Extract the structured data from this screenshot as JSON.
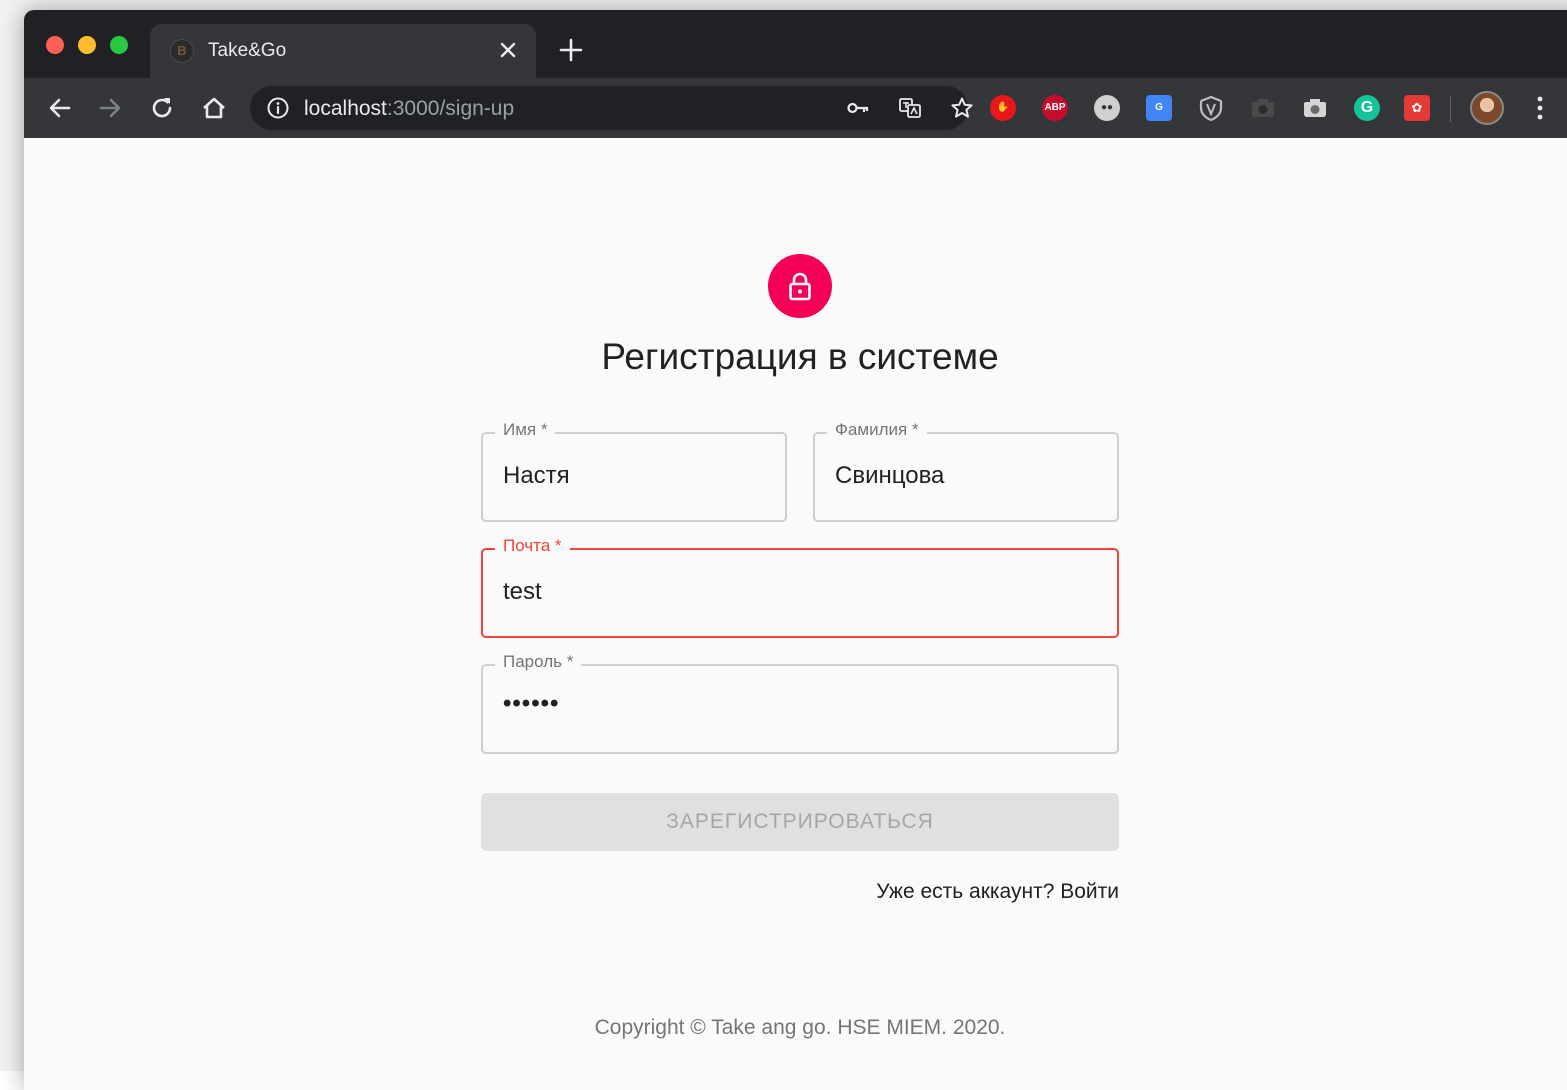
{
  "browser": {
    "tab": {
      "title": "Take&Go",
      "favicon_icon": "take-and-go-logo-icon",
      "close_icon": "close-icon"
    },
    "new_tab_icon": "plus-icon",
    "nav": {
      "back_icon": "arrow-left-icon",
      "forward_icon": "arrow-right-icon",
      "reload_icon": "reload-icon",
      "home_icon": "home-icon"
    },
    "omnibox": {
      "info_icon": "info-icon",
      "host": "localhost",
      "path": ":3000/sign-up",
      "actions": [
        "key-icon",
        "translate-icon",
        "star-icon"
      ]
    },
    "extensions": [
      {
        "name": "stop-hand-icon",
        "color": "#e8171c"
      },
      {
        "name": "adblock-plus-icon",
        "label": "ABP",
        "color": "#c70d2c"
      },
      {
        "name": "chat-bubble-icon",
        "color": "#d0d0d0"
      },
      {
        "name": "google-translate-icon",
        "color": "#4285f4"
      },
      {
        "name": "shield-icon",
        "color": "#bdbdbd"
      },
      {
        "name": "camera-dark-icon",
        "color": "#444444"
      },
      {
        "name": "camera-icon",
        "color": "#cfcfcf"
      },
      {
        "name": "grammarly-icon",
        "label": "G",
        "color": "#15c39a"
      },
      {
        "name": "paw-icon",
        "color": "#e53935"
      }
    ],
    "avatar_icon": "user-avatar",
    "menu_icon": "more-vert-icon"
  },
  "form": {
    "lock_icon": "lock-icon",
    "title": "Регистрация в системе",
    "first_name": {
      "label": "Имя *",
      "value": "Настя"
    },
    "last_name": {
      "label": "Фамилия *",
      "value": "Свинцова"
    },
    "email": {
      "label": "Почта *",
      "value": "test",
      "error": true
    },
    "password": {
      "label": "Пароль *",
      "value": "••••••"
    },
    "submit_label": "ЗАРЕГИСТРИРОВАТЬСЯ",
    "signin_link": "Уже есть аккаунт? Войти"
  },
  "footer": {
    "copyright": "Copyright © Take ang go. HSE MIEM. 2020."
  },
  "colors": {
    "accent": "#f50057",
    "error": "#f44336",
    "chrome_dark": "#202124",
    "chrome_toolbar": "#35363a"
  }
}
